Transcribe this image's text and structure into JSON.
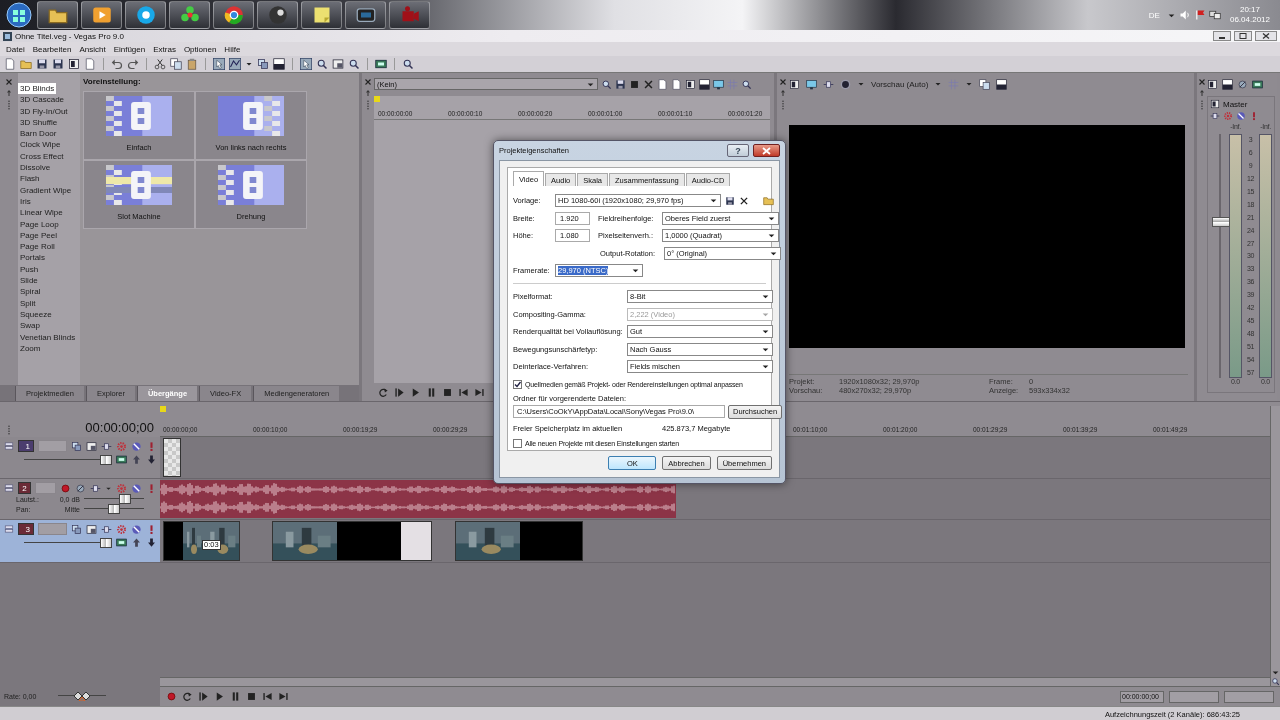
{
  "taskbar": {
    "language": "DE",
    "time": "20:17",
    "date": "06.04.2012"
  },
  "window": {
    "title": "Ohne Titel.veg - Vegas Pro 9.0"
  },
  "menu": [
    "Datei",
    "Bearbeiten",
    "Ansicht",
    "Einfügen",
    "Extras",
    "Optionen",
    "Hilfe"
  ],
  "explorer": {
    "transitions": [
      {
        "label": "3D Blinds",
        "selected": true
      },
      {
        "label": "3D Cascade",
        "selected": false
      },
      {
        "label": "3D Fly-In/Out",
        "selected": false
      },
      {
        "label": "3D Shuffle",
        "selected": false
      },
      {
        "label": "Barn Door",
        "selected": false
      },
      {
        "label": "Clock Wipe",
        "selected": false
      },
      {
        "label": "Cross Effect",
        "selected": false
      },
      {
        "label": "Dissolve",
        "selected": false
      },
      {
        "label": "Flash",
        "selected": false
      },
      {
        "label": "Gradient Wipe",
        "selected": false
      },
      {
        "label": "Iris",
        "selected": false
      },
      {
        "label": "Linear Wipe",
        "selected": false
      },
      {
        "label": "Page Loop",
        "selected": false
      },
      {
        "label": "Page Peel",
        "selected": false
      },
      {
        "label": "Page Roll",
        "selected": false
      },
      {
        "label": "Portals",
        "selected": false
      },
      {
        "label": "Push",
        "selected": false
      },
      {
        "label": "Slide",
        "selected": false
      },
      {
        "label": "Spiral",
        "selected": false
      },
      {
        "label": "Split",
        "selected": false
      },
      {
        "label": "Squeeze",
        "selected": false
      },
      {
        "label": "Swap",
        "selected": false
      },
      {
        "label": "Venetian Blinds",
        "selected": false
      },
      {
        "label": "Zoom",
        "selected": false
      }
    ],
    "preset_heading": "Voreinstellung:",
    "presets": [
      "Einfach",
      "Von links nach rechts",
      "Slot Machine",
      "Drehung"
    ],
    "tabs": [
      {
        "label": "Projektmedien",
        "selected": false
      },
      {
        "label": "Explorer",
        "selected": false
      },
      {
        "label": "Übergänge",
        "selected": true
      },
      {
        "label": "Video-FX",
        "selected": false
      },
      {
        "label": "Mediengeneratoren",
        "selected": false
      }
    ]
  },
  "trimmer": {
    "source": "(Kein)",
    "ruler": [
      "00:00:00:00",
      "00:00:00:10",
      "00:00:00:20",
      "00:00:01:00",
      "00:00:01:10",
      "00:00:01:20"
    ]
  },
  "preview": {
    "mode": "Vorschau (Auto)",
    "info": [
      {
        "label": "Projekt:",
        "value": "1920x1080x32; 29,970p"
      },
      {
        "label": "Vorschau:",
        "value": "480x270x32; 29,970p"
      },
      {
        "label": "Frame:",
        "value": "0"
      },
      {
        "label": "Anzeige:",
        "value": "593x334x32"
      }
    ]
  },
  "mixer": {
    "title": "Master",
    "peaks": [
      "-Inf.",
      "-Inf."
    ],
    "scale": [
      "3",
      "6",
      "9",
      "12",
      "15",
      "18",
      "21",
      "24",
      "27",
      "30",
      "33",
      "36",
      "39",
      "42",
      "45",
      "48",
      "51",
      "54",
      "57"
    ],
    "fader": {
      "level": 0.64
    },
    "readings": [
      "0.0",
      "0.0"
    ]
  },
  "timeline": {
    "timecode": "00:00:00;00",
    "ruler": {
      "start_labels": [
        "00:00:00;00",
        "00:00:10;00",
        "00:00:19;29",
        "00:00:29;29"
      ],
      "end_labels": [
        "00:01:10;00",
        "00:01:20;00",
        "00:01:29;29",
        "00:01:39;29",
        "00:01:49;29"
      ]
    },
    "tracks": [
      {
        "number": "1",
        "kind": "video",
        "color": "#4b3d6e",
        "selected": false,
        "slider": {
          "level": 1
        },
        "clips": [
          {
            "kind": "generated"
          }
        ]
      },
      {
        "number": "2",
        "kind": "audio",
        "color": "#6b2a36",
        "selected": false,
        "volume": {
          "label": "Lautst.:",
          "reading": "0,0 dB",
          "level": 0.72
        },
        "pan": {
          "label": "Pan:",
          "reading": "Mitte",
          "level": 0.5
        },
        "clips": [
          {
            "kind": "audio"
          }
        ]
      },
      {
        "number": "3",
        "kind": "video",
        "color": "#6b2a36",
        "selected": true,
        "slider": {
          "level": 1
        },
        "clips": [
          {
            "kind": "video",
            "tooltip": "0:03"
          },
          {
            "kind": "video"
          },
          {
            "kind": "video"
          }
        ]
      }
    ],
    "rate": "Rate: 0,00",
    "rate_slider": {
      "level": 0.5
    },
    "transport_timecode": "00:00:00;00"
  },
  "status_bar": {
    "text": "Aufzeichnungszeit (2 Kanäle): 686:43:25"
  },
  "dialog": {
    "title": "Projekteigenschaften",
    "help": "?",
    "tabs": [
      {
        "label": "Video",
        "selected": true
      },
      {
        "label": "Audio",
        "selected": false
      },
      {
        "label": "Skala",
        "selected": false
      },
      {
        "label": "Zusammenfassung",
        "selected": false
      },
      {
        "label": "Audio-CD",
        "selected": false
      }
    ],
    "template": {
      "label": "Vorlage:",
      "value": "HD 1080-60i (1920x1080; 29,970 fps)"
    },
    "width": {
      "label": "Breite:",
      "value": "1.920"
    },
    "height": {
      "label": "Höhe:",
      "value": "1.080"
    },
    "field_order": {
      "label": "Fieldreihenfolge:",
      "value": "Oberes Field zuerst"
    },
    "pixel_aspect": {
      "label": "Pixelseitenverh.:",
      "value": "1,0000 (Quadrat)"
    },
    "output_rotation": {
      "label": "Output-Rotation:",
      "value": "0° (Original)"
    },
    "framerate": {
      "label": "Framerate:",
      "value": "29,970 (NTSC)",
      "selected": true
    },
    "settings": [
      {
        "label": "Pixelformat:",
        "value": "8-Bit",
        "disabled": false
      },
      {
        "label": "Compositing-Gamma:",
        "value": "2,222 (Video)",
        "disabled": true
      },
      {
        "label": "Renderqualität bei Vollauflösung:",
        "value": "Gut",
        "disabled": false
      },
      {
        "label": "Bewegungsunschärfetyp:",
        "value": "Nach Gauss",
        "disabled": false
      },
      {
        "label": "Deinterlace-Verfahren:",
        "value": "Fields mischen",
        "disabled": false
      }
    ],
    "adapt_media": {
      "label": "Quellmedien gemäß Projekt- oder Rendereinstellungen optimal anpassen",
      "checked": true
    },
    "folder": {
      "label": "Ordner für vorgerenderte Dateien:",
      "value": "C:\\Users\\CoOkY\\AppData\\Local\\Sony\\Vegas Pro\\9.0\\",
      "browse": "Durchsuchen"
    },
    "free_space": {
      "label": "Freier Speicherplatz im aktuellen",
      "value": "425.873,7 Megabyte"
    },
    "start_all": {
      "label": "Alle neuen Projekte mit diesen Einstellungen starten",
      "checked": false
    },
    "buttons": [
      {
        "label": "OK",
        "default": true
      },
      {
        "label": "Abbrechen",
        "default": false
      },
      {
        "label": "Übernehmen",
        "default": false
      }
    ]
  }
}
